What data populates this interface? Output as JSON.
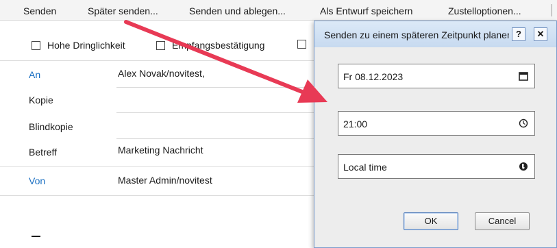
{
  "toolbar": {
    "send": "Senden",
    "send_later": "Später senden...",
    "send_and_file": "Senden und ablegen...",
    "save_draft": "Als Entwurf speichern",
    "delivery_options": "Zustelloptionen..."
  },
  "options": {
    "high_priority": "Hohe Dringlichkeit",
    "read_receipt": "Empfangsbestätigung"
  },
  "fields": {
    "to_label": "An",
    "to_value": "Alex Novak/novitest,",
    "cc_label": "Kopie",
    "bcc_label": "Blindkopie",
    "subject_label": "Betreff",
    "subject_value": "Marketing Nachricht",
    "from_label": "Von",
    "from_value": "Master Admin/novitest"
  },
  "dialog": {
    "title": "Senden zu einem späteren Zeitpunkt planen",
    "help_glyph": "?",
    "close_glyph": "✕",
    "date_value": "Fr 08.12.2023",
    "time_value": "21:00",
    "timezone_value": "Local time",
    "ok_label": "OK",
    "cancel_label": "Cancel"
  },
  "icons": {
    "date": "calendar-icon",
    "time": "clock-icon",
    "timezone": "globe-icon"
  },
  "colors": {
    "link_label": "#1a6fc2",
    "annotation_arrow": "#e83a55",
    "dialog_border": "#7a9ccc"
  }
}
